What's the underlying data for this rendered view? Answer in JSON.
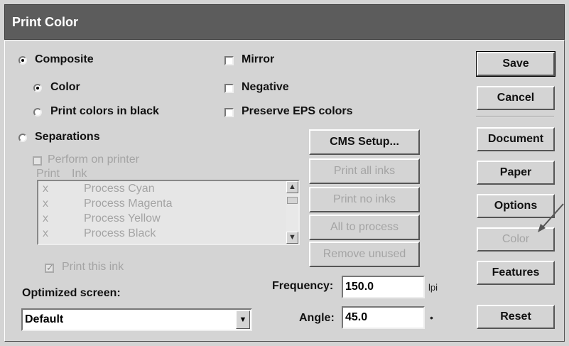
{
  "window": {
    "title": "Print Color"
  },
  "mode": {
    "composite_label": "Composite",
    "color_label": "Color",
    "print_black_label": "Print colors in black",
    "separations_label": "Separations"
  },
  "options": {
    "mirror_label": "Mirror",
    "negative_label": "Negative",
    "preserve_eps_label": "Preserve EPS colors"
  },
  "separations": {
    "perform_on_printer_label": "Perform on printer",
    "columns": [
      "Print",
      "Ink"
    ],
    "inks": [
      {
        "print": "x",
        "name": "Process Cyan"
      },
      {
        "print": "x",
        "name": "Process Magenta"
      },
      {
        "print": "x",
        "name": "Process Yellow"
      },
      {
        "print": "x",
        "name": "Process Black"
      }
    ],
    "print_this_ink_label": "Print this ink"
  },
  "ink_buttons": {
    "cms_setup": "CMS Setup...",
    "print_all": "Print all inks",
    "print_none": "Print no inks",
    "all_to_process": "All to process",
    "remove_unused": "Remove unused"
  },
  "screen": {
    "optimized_label": "Optimized screen:",
    "selected": "Default"
  },
  "halftone": {
    "frequency_label": "Frequency:",
    "frequency_value": "150.0",
    "frequency_unit": "lpi",
    "angle_label": "Angle:",
    "angle_value": "45.0",
    "angle_unit": "•"
  },
  "side_buttons": {
    "save": "Save",
    "cancel": "Cancel",
    "document": "Document",
    "paper": "Paper",
    "options": "Options",
    "color": "Color",
    "features": "Features",
    "reset": "Reset"
  },
  "icons": [
    "radio-selected-icon",
    "radio-empty-icon",
    "checkbox-empty-icon",
    "checkbox-checked-icon",
    "scroll-up-icon",
    "scroll-down-icon",
    "dropdown-arrow-icon",
    "pointer-arrow-icon"
  ],
  "colors": {
    "titlebar": "#5c5c5c",
    "dialog": "#d4d4d4"
  }
}
